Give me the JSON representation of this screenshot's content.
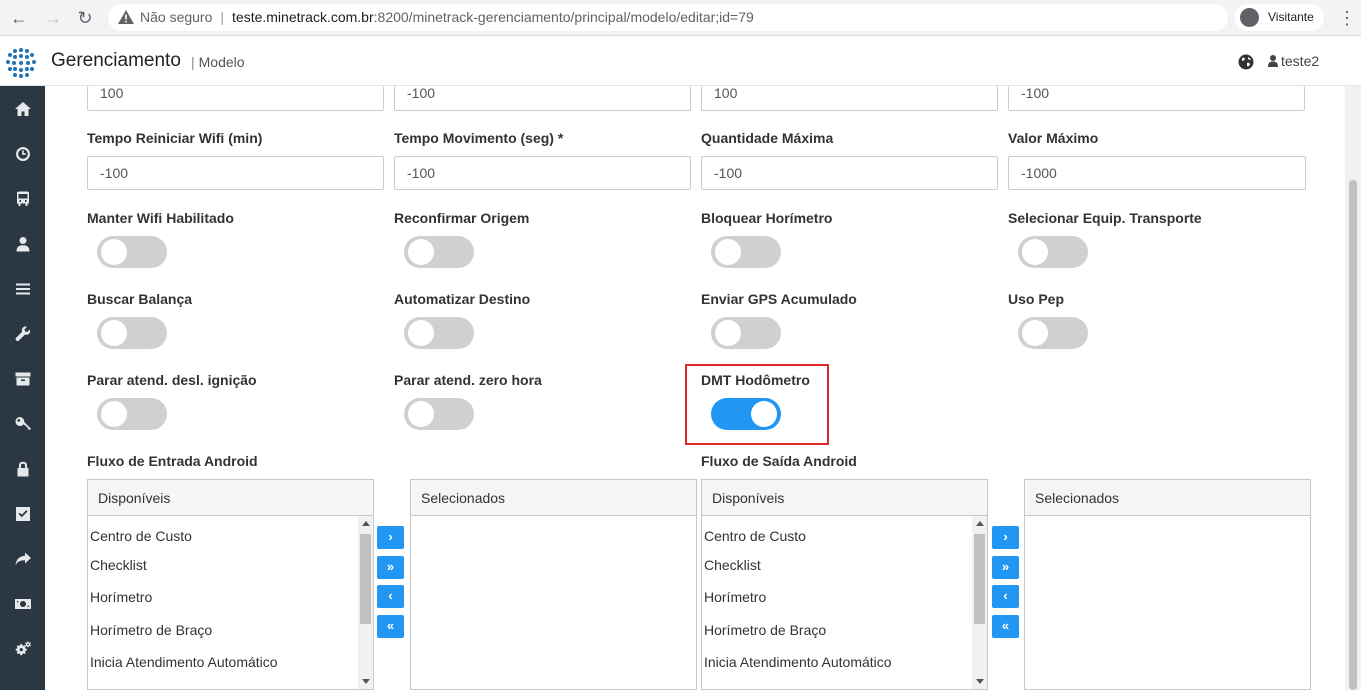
{
  "browser": {
    "insecure_label": "Não seguro",
    "url_host": "teste.minetrack.com.br",
    "url_path": ":8200/minetrack-gerenciamento/principal/modelo/editar;id=79",
    "profile_label": "Visitante"
  },
  "header": {
    "title": "Gerenciamento",
    "subtitle": "Modelo",
    "user": "teste2"
  },
  "sidebar": {
    "items": [
      "home-icon",
      "dashboard-icon",
      "bus-icon",
      "user-icon",
      "menu-icon",
      "wrench-icon",
      "archive-icon",
      "key-icon",
      "lock-icon",
      "checkbox-icon",
      "share-icon",
      "money-icon",
      "gears-icon"
    ]
  },
  "top_inputs": [
    "100",
    "-100",
    "100",
    "-100"
  ],
  "fields_row2": [
    {
      "label": "Tempo Reiniciar Wifi (min)",
      "value": "-100"
    },
    {
      "label": "Tempo Movimento (seg) *",
      "value": "-100"
    },
    {
      "label": "Quantidade Máxima",
      "value": "-100"
    },
    {
      "label": "Valor Máximo",
      "value": "-1000"
    }
  ],
  "toggles": [
    {
      "label": "Manter Wifi Habilitado",
      "on": false
    },
    {
      "label": "Reconfirmar Origem",
      "on": false
    },
    {
      "label": "Bloquear Horímetro",
      "on": false
    },
    {
      "label": "Selecionar Equip. Transporte",
      "on": false
    },
    {
      "label": "Buscar Balança",
      "on": false
    },
    {
      "label": "Automatizar Destino",
      "on": false
    },
    {
      "label": "Enviar GPS Acumulado",
      "on": false
    },
    {
      "label": "Uso Pep",
      "on": false
    },
    {
      "label": "Parar atend. desl. ignição",
      "on": false
    },
    {
      "label": "Parar atend. zero hora",
      "on": false
    },
    {
      "label": "DMT Hodômetro",
      "on": true
    }
  ],
  "flow_in": {
    "label": "Fluxo de Entrada Android",
    "available_label": "Disponíveis",
    "selected_label": "Selecionados",
    "options": [
      "Centro de Custo",
      "Checklist",
      "Horímetro",
      "Horímetro de Braço",
      "Inicia Atendimento Automático"
    ]
  },
  "flow_out": {
    "label": "Fluxo de Saída Android",
    "available_label": "Disponíveis",
    "selected_label": "Selecionados",
    "options": [
      "Centro de Custo",
      "Checklist",
      "Horímetro",
      "Horímetro de Braço",
      "Inicia Atendimento Automático"
    ]
  },
  "move_buttons": [
    "›",
    "»",
    "‹",
    "«"
  ],
  "colors": {
    "accent": "#2196f3",
    "sidebar": "#2b3844",
    "highlight": "#e02727"
  }
}
